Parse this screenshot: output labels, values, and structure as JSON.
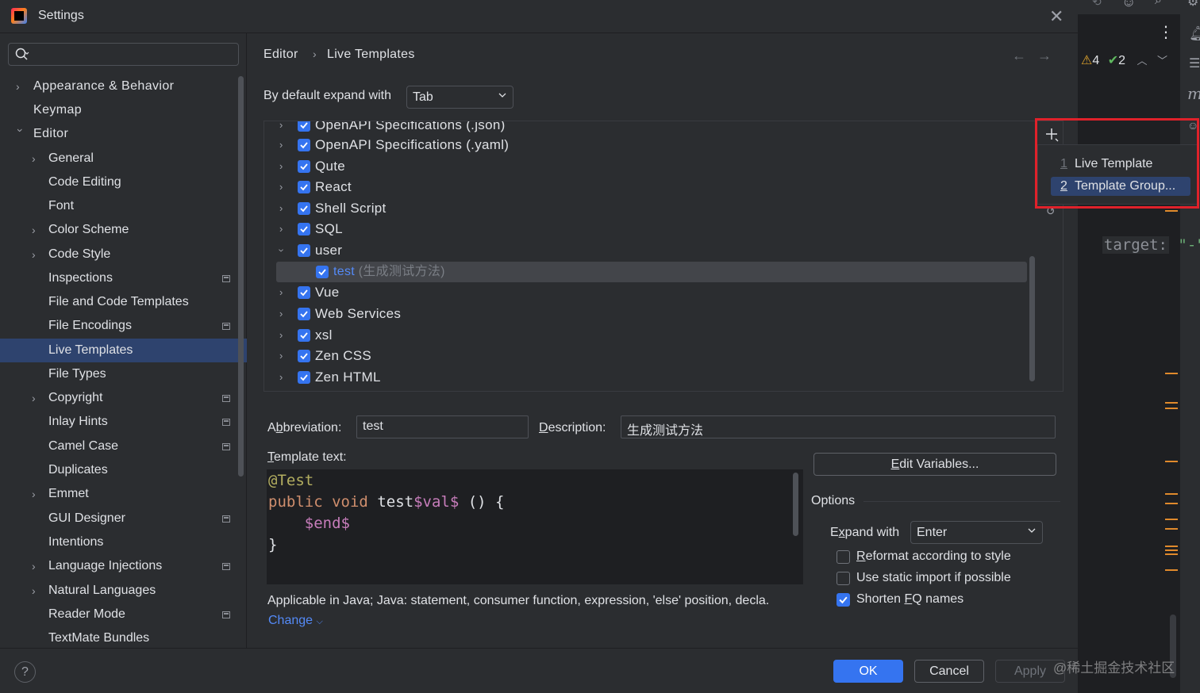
{
  "window": {
    "title": "Settings"
  },
  "search": {
    "placeholder": ""
  },
  "sidebar": {
    "items": [
      {
        "label": "Appearance & Behavior"
      },
      {
        "label": "Keymap"
      },
      {
        "label": "Editor"
      },
      {
        "label": "General"
      },
      {
        "label": "Code Editing"
      },
      {
        "label": "Font"
      },
      {
        "label": "Color Scheme"
      },
      {
        "label": "Code Style"
      },
      {
        "label": "Inspections"
      },
      {
        "label": "File and Code Templates"
      },
      {
        "label": "File Encodings"
      },
      {
        "label": "Live Templates"
      },
      {
        "label": "File Types"
      },
      {
        "label": "Copyright"
      },
      {
        "label": "Inlay Hints"
      },
      {
        "label": "Camel Case"
      },
      {
        "label": "Duplicates"
      },
      {
        "label": "Emmet"
      },
      {
        "label": "GUI Designer"
      },
      {
        "label": "Intentions"
      },
      {
        "label": "Language Injections"
      },
      {
        "label": "Natural Languages"
      },
      {
        "label": "Reader Mode"
      },
      {
        "label": "TextMate Bundles"
      }
    ]
  },
  "breadcrumb": {
    "parent": "Editor",
    "current": "Live Templates"
  },
  "expand": {
    "label": "By default expand with",
    "value": "Tab"
  },
  "tree": {
    "rows": [
      {
        "label": "OpenAPI Specifications (.json)"
      },
      {
        "label": "OpenAPI Specifications (.yaml)"
      },
      {
        "label": "Qute"
      },
      {
        "label": "React"
      },
      {
        "label": "Shell Script"
      },
      {
        "label": "SQL"
      },
      {
        "label": "user"
      },
      {
        "label": "test",
        "description": "(生成测试方法)"
      },
      {
        "label": "Vue"
      },
      {
        "label": "Web Services"
      },
      {
        "label": "xsl"
      },
      {
        "label": "Zen CSS"
      },
      {
        "label": "Zen HTML"
      }
    ]
  },
  "popup": {
    "items": [
      {
        "num": "1",
        "label": "Live Template"
      },
      {
        "num": "2",
        "label": "Template Group..."
      }
    ]
  },
  "form": {
    "abbreviation_label_pre": "A",
    "abbreviation_label_u": "b",
    "abbreviation_label_post": "breviation:",
    "abbreviation_value": "test",
    "description_label_u": "D",
    "description_label_post": "escription:",
    "description_value": "生成测试方法",
    "template_text_label_u": "T",
    "template_text_label_post": "emplate text:",
    "code_lines": {
      "line1": "@Test",
      "line2_kw1": "public",
      "line2_kw2": "void",
      "line2_name": "test",
      "line2_var": "$val$",
      "line2_rest": " () {",
      "line3_var": "$end$",
      "line4": "}"
    },
    "edit_variables_u": "E",
    "edit_variables_post": "dit Variables...",
    "options_label": "Options",
    "expand_with_pre": "E",
    "expand_with_u": "x",
    "expand_with_post": "pand with",
    "expand_with_value": "Enter",
    "opt_reformat_u": "R",
    "opt_reformat_post": "eformat according to style",
    "opt_static": "Use static import if possible",
    "opt_shorten_pre": "Shorten ",
    "opt_shorten_u": "F",
    "opt_shorten_post": "Q names",
    "applicable": "Applicable in Java; Java: statement, consumer function, expression, 'else' position, decla.",
    "change_link": "Change"
  },
  "footer": {
    "help": "?",
    "ok": "OK",
    "cancel": "Cancel",
    "apply": "Apply"
  },
  "ide": {
    "warnings": "4",
    "checks": "2",
    "code_param": "target:",
    "code_str": "\"-\"",
    "code_comma": ",",
    "italic_glyph": "m"
  },
  "watermark": "@稀土掘金技术社区",
  "colors": {
    "accent": "#3574f0",
    "selection": "#2e436e",
    "highlight_box": "#e0212a",
    "keyword": "#cf8e6d",
    "template_var": "#c77dbb"
  }
}
